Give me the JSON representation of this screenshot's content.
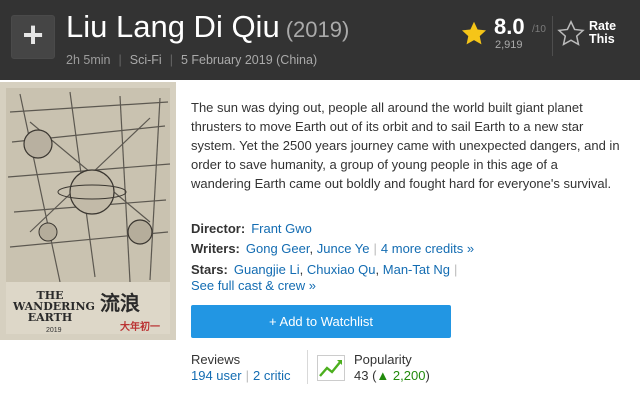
{
  "header": {
    "add_label": "+",
    "title": "Liu Lang Di Qiu",
    "year": "(2019)",
    "runtime": "2h 5min",
    "genre": "Sci-Fi",
    "release": "5 February 2019 (China)"
  },
  "rating": {
    "value": "8.0",
    "best": "/10",
    "count": "2,919",
    "rate_label_1": "Rate",
    "rate_label_2": "This",
    "star_color": "#f5c518"
  },
  "poster": {
    "title_line1": "THE",
    "title_line2": "WANDERING",
    "title_line3": "EARTH",
    "year": "2019"
  },
  "summary": "The sun was dying out, people all around the world built giant planet thrusters to move Earth out of its orbit and to sail Earth to a new star system. Yet the 2500 years journey came with unexpected dangers, and in order to save humanity, a group of young people in this age of a wandering Earth came out boldly and fought hard for everyone's survival.",
  "credits": {
    "director_label": "Director:",
    "director": "Frant Gwo",
    "writers_label": "Writers:",
    "writers": [
      "Gong Geer",
      "Junce Ye"
    ],
    "writers_more": "4 more credits »",
    "stars_label": "Stars:",
    "stars": [
      "Guangjie Li",
      "Chuxiao Qu",
      "Man-Tat Ng"
    ],
    "full_cast": "See full cast & crew »"
  },
  "watchlist": {
    "label": "+ Add to Watchlist",
    "color": "#2296e3"
  },
  "reviews": {
    "label": "Reviews",
    "user": "194 user",
    "critic": "2 critic"
  },
  "popularity": {
    "label": "Popularity",
    "rank": "43",
    "change": "2,200",
    "change_color": "#218a0c"
  }
}
